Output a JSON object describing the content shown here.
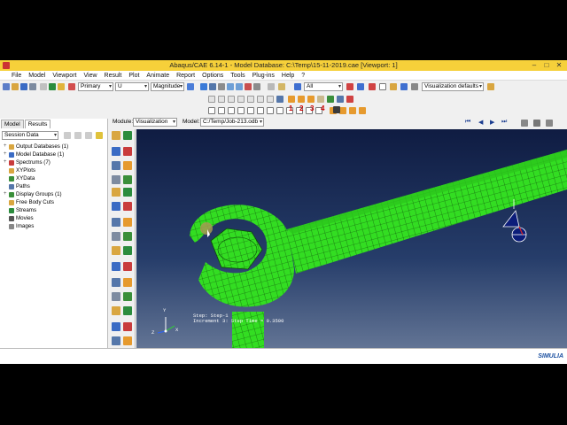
{
  "window": {
    "title": "Abaqus/CAE 6.14-1 - Model Database: C:\\Temp\\15-11-2019.cae [Viewport: 1]"
  },
  "menu": [
    "File",
    "Model",
    "Viewport",
    "View",
    "Result",
    "Plot",
    "Animate",
    "Report",
    "Options",
    "Tools",
    "Plug-ins",
    "Help",
    "?"
  ],
  "toolbar": {
    "primary_select": "Primary",
    "variable_select": "U",
    "invariant_select": "Magnitude",
    "filter_select": "All",
    "visualization_select": "Visualization defaults",
    "numbers": [
      "1",
      "2",
      "3",
      "4"
    ]
  },
  "context": {
    "module_label": "Module:",
    "module_value": "Visualization",
    "model_label": "Model:",
    "model_value": "C:/Temp/Job-213.odb"
  },
  "left_panel": {
    "tabs": [
      "Model",
      "Results"
    ],
    "active_tab": "Results",
    "session_select": "Session Data",
    "tree": [
      {
        "label": "Output Databases (1)",
        "expand": "+"
      },
      {
        "label": "Model Database (1)",
        "expand": "+"
      },
      {
        "label": "Spectrums (7)",
        "expand": "+"
      },
      {
        "label": "XYPlots",
        "expand": ""
      },
      {
        "label": "XYData",
        "expand": ""
      },
      {
        "label": "Paths",
        "expand": ""
      },
      {
        "label": "Display Groups (1)",
        "expand": "+"
      },
      {
        "label": "Free Body Cuts",
        "expand": ""
      },
      {
        "label": "Streams",
        "expand": ""
      },
      {
        "label": "Movies",
        "expand": ""
      },
      {
        "label": "Images",
        "expand": ""
      }
    ]
  },
  "viewport": {
    "step_line1": "Step: Step-1",
    "step_line2": "Increment",
    "step_line3": "3: Step Time =",
    "step_time": "0.3500",
    "triad": {
      "y": "Y",
      "z": "Z",
      "x": "X"
    }
  },
  "brand": "SIMULIA",
  "colors": {
    "titlebar": "#f6d03a",
    "mesh": "#33dd22",
    "accent_numbers": "#cc0000"
  }
}
